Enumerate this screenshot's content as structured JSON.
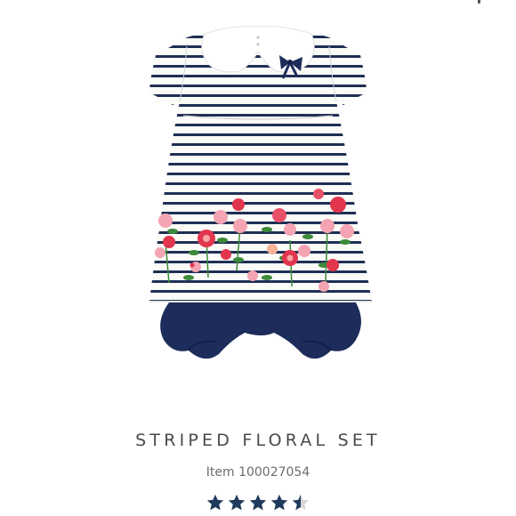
{
  "product": {
    "name": "STRIPED FLORAL SET",
    "item_number": "Item 100027054",
    "rating": {
      "value": 4.5,
      "max": 5,
      "color": "#1f3a5c",
      "empty_color": "#d6d6d6"
    },
    "image": {
      "description_icon": "striped-floral-dress-with-bloomers-image",
      "stripe_color": "#1f2f55",
      "bloomers_color": "#1d2c5a",
      "collar_color": "#ffffff"
    }
  }
}
